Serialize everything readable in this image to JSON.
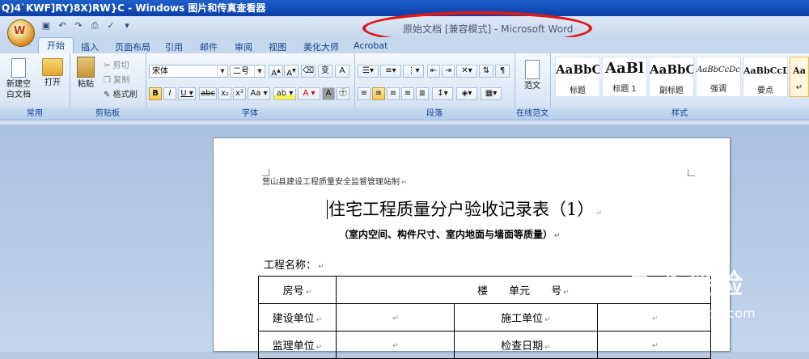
{
  "viewer": {
    "title": "Q)4`KWF]RY)8X)RW}C - Windows 图片和传真查看器"
  },
  "word": {
    "doc_title": "原始文档 [兼容模式] - Microsoft Word",
    "tabs": [
      "开始",
      "插入",
      "页面布局",
      "引用",
      "邮件",
      "审阅",
      "视图",
      "美化大师",
      "Acrobat"
    ],
    "active_tab": "开始"
  },
  "ribbon": {
    "common": {
      "label": "常用",
      "new_doc": "新建空白文档",
      "open": "打开"
    },
    "clipboard": {
      "label": "剪贴板",
      "paste": "粘贴",
      "cut": "剪切",
      "copy": "复制",
      "format_painter": "格式刷"
    },
    "font": {
      "label": "字体",
      "name": "宋体",
      "size": "二号"
    },
    "paragraph": {
      "label": "段落"
    },
    "online": {
      "label": "在线范文",
      "sample": "范文"
    },
    "styles": {
      "label": "样式",
      "items": [
        {
          "sample": "AaBbC(",
          "name": "标题"
        },
        {
          "sample": "AaBl",
          "name": "标题 1"
        },
        {
          "sample": "AaBbC",
          "name": "副标题"
        },
        {
          "sample": "AaBbCcDc",
          "name": "强调"
        },
        {
          "sample": "AaBbCcD",
          "name": "要点"
        },
        {
          "sample": "Aa",
          "name": "↵"
        }
      ]
    }
  },
  "document": {
    "header": "营山县建设工程质量安全监督管理站制",
    "title": "住宅工程质量分户验收记录表（1）",
    "subtitle": "（室内空间、构件尺寸、室内地面与墙面等质量）",
    "project_label": "工程名称：",
    "table": {
      "row1": {
        "label": "房号",
        "value": "楼　　单元　　号"
      },
      "row2": {
        "label": "建设单位",
        "label2": "施工单位"
      },
      "row3": {
        "label": "监理单位",
        "label2": "检查日期"
      }
    },
    "para_mark": "↵"
  },
  "watermark": {
    "text": "Bai 经验",
    "url": "jingyan.baidu.com"
  }
}
